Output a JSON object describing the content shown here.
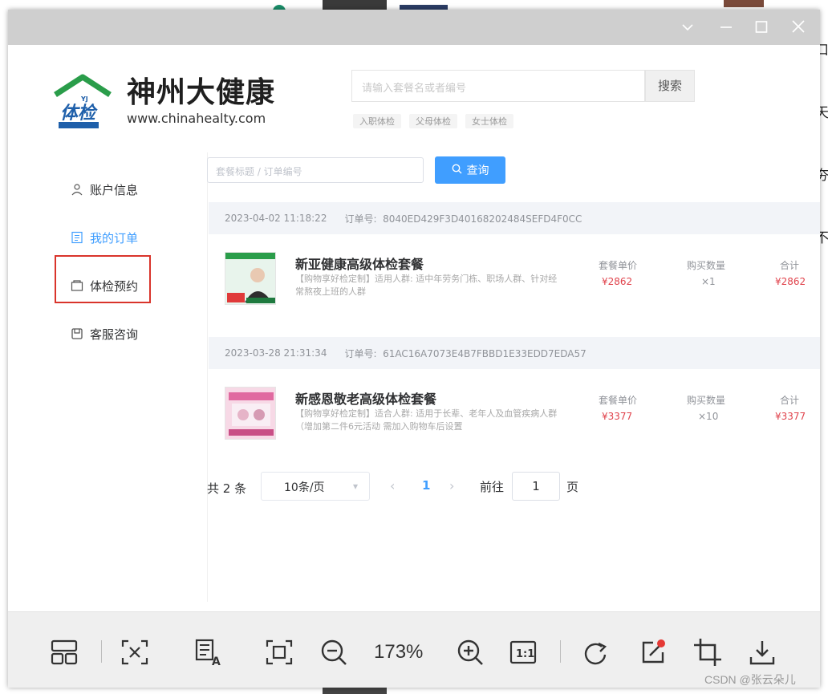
{
  "page": {
    "brand": {
      "name": "神州大健康",
      "url": "www.chinahealty.com",
      "badge_text": "体检"
    },
    "search": {
      "placeholder": "请输入套餐名或者编号",
      "button_label": "搜索",
      "hot_tags": [
        "入职体检",
        "父母体检",
        "女士体检"
      ]
    },
    "side_nav": [
      {
        "label": "账户信息",
        "icon": "user-icon",
        "active": false
      },
      {
        "label": "我的订单",
        "icon": "document-icon",
        "active": true
      },
      {
        "label": "体检预约",
        "icon": "tray-icon",
        "active": false,
        "highlighted": true
      },
      {
        "label": "客服咨询",
        "icon": "message-icon",
        "active": false
      }
    ],
    "filter": {
      "placeholder": "套餐标题 / 订单编号",
      "button_label": "查询"
    },
    "orders": [
      {
        "date": "2023-04-02 11:18:22",
        "order_no_label": "订单号:",
        "order_no": "8040ED429F3D40168202484SEFD4F0CC",
        "title": "新亚健康高级体检套餐",
        "desc": "【购物享好检定制】适用人群: 适中年劳务门栋、职场人群、针对经常熬夜上班的人群",
        "unit_price_label": "套餐单价",
        "unit_price": "¥2862",
        "qty_label": "购买数量",
        "qty": "×1",
        "total_label": "合计",
        "total": "¥2862"
      },
      {
        "date": "2023-03-28 21:31:34",
        "order_no_label": "订单号:",
        "order_no": "61AC16A7073E4B7FBBD1E33EDD7EDA57",
        "title": "新感恩敬老高级体检套餐",
        "desc": "【购物享好检定制】适合人群: 适用于长辈、老年人及血管疾病人群（增加第二件6元活动 需加入购物车后设置",
        "unit_price_label": "套餐单价",
        "unit_price": "¥3377",
        "qty_label": "购买数量",
        "qty": "×10",
        "total_label": "合计",
        "total": "¥3377"
      }
    ],
    "pagination": {
      "total_text": "共 2 条",
      "page_size": "10条/页",
      "current_page": "1",
      "goto_label": "前往",
      "goto_value": "1",
      "goto_unit": "页"
    }
  },
  "viewer": {
    "zoom": "173%",
    "toolbar_icons": [
      "layout-icon",
      "fit-icon",
      "ocr-icon",
      "actual-frame-icon",
      "zoom-out-icon",
      "zoom-in-icon",
      "one-to-one-icon",
      "rotate-icon",
      "edit-icon",
      "crop-icon",
      "download-icon"
    ],
    "window_buttons": [
      "chevron-down-icon",
      "minimize-icon",
      "maximize-icon",
      "close-icon"
    ]
  },
  "watermark": "CSDN @张云朵儿",
  "background_fragments": [
    "口",
    "天",
    "夯",
    "不"
  ],
  "colors": {
    "accent": "#409eff",
    "price": "#e0424b",
    "highlight_box": "#d9342b",
    "titlebar": "#cfcfcf",
    "toolbar": "#efefef",
    "brand_green": "#2a9d4a",
    "brand_blue": "#1e5faa"
  }
}
